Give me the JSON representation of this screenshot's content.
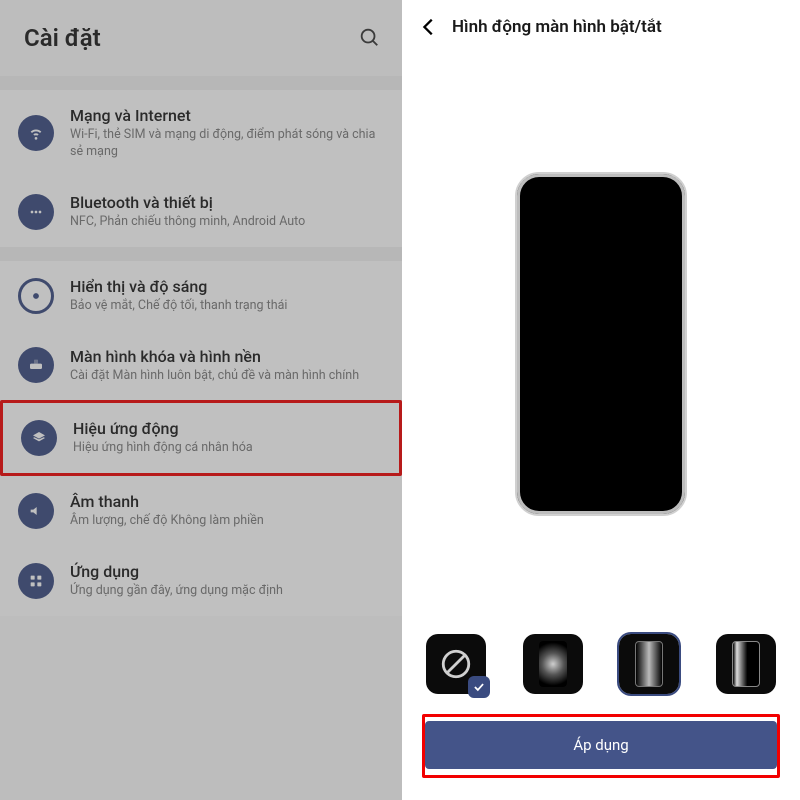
{
  "left": {
    "title": "Cài đặt",
    "items": [
      {
        "icon": "wifi",
        "title": "Mạng và Internet",
        "sub": "Wi-Fi, thẻ SIM và mạng di động, điểm phát sóng và chia sẻ mạng"
      },
      {
        "icon": "dots",
        "title": "Bluetooth và thiết bị",
        "sub": "NFC, Phản chiếu thông minh, Android Auto"
      },
      {
        "icon": "ring",
        "title": "Hiển thị và độ sáng",
        "sub": "Bảo vệ mắt, Chế độ tối, thanh trạng thái"
      },
      {
        "icon": "dock",
        "title": "Màn hình khóa và hình nền",
        "sub": "Cài đặt Màn hình luôn bật, chủ đề và màn hình chính"
      },
      {
        "icon": "layers",
        "title": "Hiệu ứng động",
        "sub": "Hiệu ứng hình động cá nhân hóa",
        "highlight": true
      },
      {
        "icon": "sound",
        "title": "Âm thanh",
        "sub": "Âm lượng, chế độ Không làm phiền"
      },
      {
        "icon": "apps",
        "title": "Ứng dụng",
        "sub": "Ứng dụng gần đây, ứng dụng mặc định"
      }
    ]
  },
  "right": {
    "title": "Hình động màn hình bật/tắt",
    "options": [
      {
        "name": "none",
        "selected": true
      },
      {
        "name": "glow",
        "selected": false
      },
      {
        "name": "vertical",
        "selected": false,
        "outline": true
      },
      {
        "name": "slide",
        "selected": false
      }
    ],
    "apply_label": "Áp dụng"
  }
}
